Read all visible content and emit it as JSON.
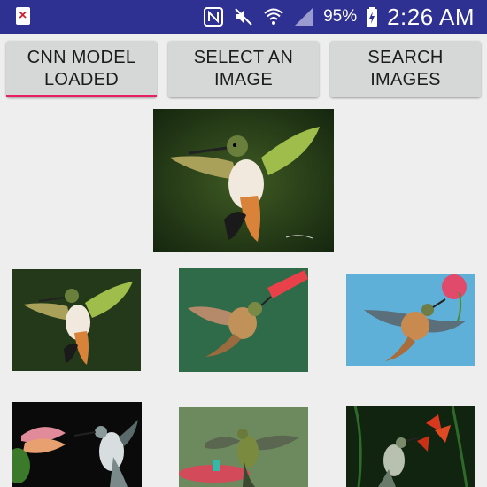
{
  "status_bar": {
    "icons": [
      "notification-error-icon",
      "nfc-icon",
      "mute-icon",
      "wifi-icon",
      "signal-icon",
      "battery-charging-icon"
    ],
    "battery": "95%",
    "time": "2:26 AM"
  },
  "toolbar": {
    "cnn_label": "CNN MODEL\nLOADED",
    "select_label": "SELECT AN\nIMAGE",
    "search_label": "SEARCH\nIMAGES"
  },
  "images": {
    "query": "hummingbird-query-image",
    "results": [
      "hummingbird-result-1",
      "hummingbird-result-2",
      "hummingbird-result-3",
      "hummingbird-result-4",
      "hummingbird-result-5",
      "hummingbird-result-6"
    ]
  },
  "colors": {
    "status_bar": "#2e3191",
    "accent": "#e91e63",
    "button": "#d6d7d7",
    "background": "#eeeeee"
  }
}
